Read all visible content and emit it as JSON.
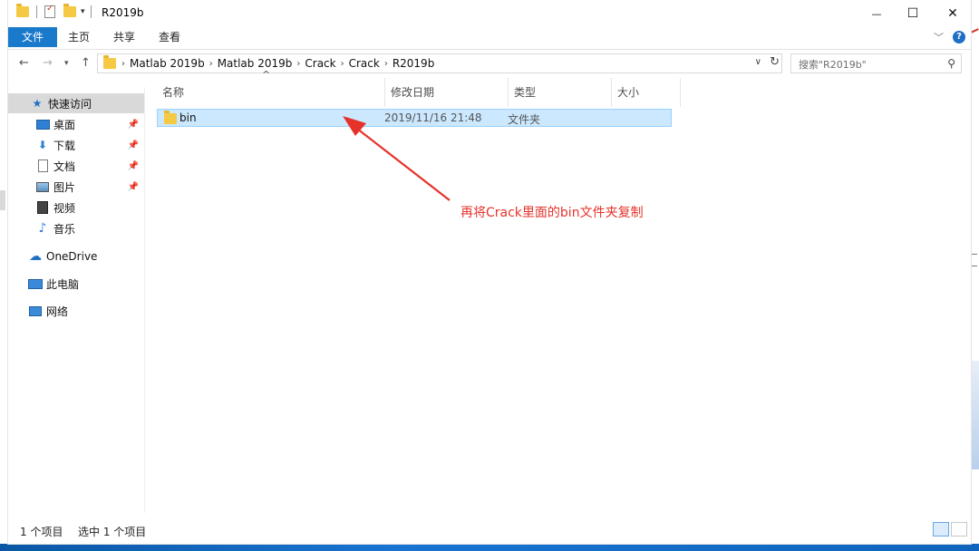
{
  "window": {
    "title": "R2019b",
    "controls": {
      "minimize": "—",
      "maximize": "☐",
      "close": "✕"
    }
  },
  "ribbon": {
    "tabs": [
      "文件",
      "主页",
      "共享",
      "查看"
    ]
  },
  "address": {
    "crumbs": [
      "Matlab 2019b",
      "Matlab 2019b",
      "Crack",
      "Crack",
      "R2019b"
    ],
    "search_placeholder": "搜索\"R2019b\""
  },
  "sidebar": {
    "items": [
      {
        "label": "快速访问",
        "icon": "star-icon",
        "pinned": false
      },
      {
        "label": "桌面",
        "icon": "desktop-icon",
        "pinned": true
      },
      {
        "label": "下载",
        "icon": "download-icon",
        "pinned": true
      },
      {
        "label": "文档",
        "icon": "document-icon",
        "pinned": true
      },
      {
        "label": "图片",
        "icon": "picture-icon",
        "pinned": true
      },
      {
        "label": "视频",
        "icon": "video-icon",
        "pinned": false
      },
      {
        "label": "音乐",
        "icon": "music-icon",
        "pinned": false
      },
      {
        "label": "OneDrive",
        "icon": "cloud-icon",
        "pinned": false
      },
      {
        "label": "此电脑",
        "icon": "computer-icon",
        "pinned": false
      },
      {
        "label": "网络",
        "icon": "network-icon",
        "pinned": false
      }
    ]
  },
  "columns": [
    "名称",
    "修改日期",
    "类型",
    "大小"
  ],
  "files": [
    {
      "name": "bin",
      "modified": "2019/11/16 21:48",
      "type": "文件夹",
      "size": ""
    }
  ],
  "annotation": "再将Crack里面的bin文件夹复制",
  "status": {
    "count": "1 个项目",
    "selected": "选中 1 个项目"
  },
  "colors": {
    "accent": "#1979ca",
    "selection": "#cce8ff",
    "annotation": "#e5332a"
  }
}
